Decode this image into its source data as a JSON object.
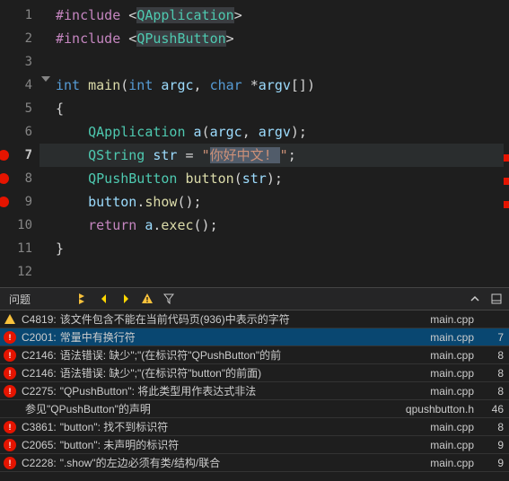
{
  "editor": {
    "currentLine": 7,
    "errorLines": [
      7,
      8,
      9
    ],
    "lines": [
      {
        "num": 1,
        "tokens": [
          {
            "t": "#include ",
            "c": "k-pre"
          },
          {
            "t": "<",
            "c": "k-ang"
          },
          {
            "t": "QApplication",
            "c": "k-inc"
          },
          {
            "t": ">",
            "c": "k-ang"
          }
        ]
      },
      {
        "num": 2,
        "tokens": [
          {
            "t": "#include ",
            "c": "k-pre"
          },
          {
            "t": "<",
            "c": "k-ang"
          },
          {
            "t": "QPushButton",
            "c": "k-inc"
          },
          {
            "t": ">",
            "c": "k-ang"
          }
        ]
      },
      {
        "num": 3,
        "tokens": []
      },
      {
        "num": 4,
        "tokens": [
          {
            "t": "int ",
            "c": "k-key"
          },
          {
            "t": "main",
            "c": "k-func"
          },
          {
            "t": "(",
            "c": "k-punc"
          },
          {
            "t": "int ",
            "c": "k-key"
          },
          {
            "t": "argc",
            "c": "k-var"
          },
          {
            "t": ", ",
            "c": "k-punc"
          },
          {
            "t": "char ",
            "c": "k-key"
          },
          {
            "t": "*",
            "c": "k-punc"
          },
          {
            "t": "argv",
            "c": "k-var"
          },
          {
            "t": "[])",
            "c": "k-punc"
          }
        ]
      },
      {
        "num": 5,
        "tokens": [
          {
            "t": "{",
            "c": "k-punc"
          }
        ]
      },
      {
        "num": 6,
        "tokens": [
          {
            "t": "    ",
            "c": ""
          },
          {
            "t": "QApplication ",
            "c": "k-type"
          },
          {
            "t": "a",
            "c": "k-var"
          },
          {
            "t": "(",
            "c": "k-punc"
          },
          {
            "t": "argc",
            "c": "k-var"
          },
          {
            "t": ", ",
            "c": "k-punc"
          },
          {
            "t": "argv",
            "c": "k-var"
          },
          {
            "t": ");",
            "c": "k-punc"
          }
        ]
      },
      {
        "num": 7,
        "tokens": [
          {
            "t": "    ",
            "c": ""
          },
          {
            "t": "QString ",
            "c": "k-type"
          },
          {
            "t": "str ",
            "c": "k-var"
          },
          {
            "t": "= ",
            "c": "k-punc"
          },
          {
            "t": "\"",
            "c": "k-str"
          },
          {
            "t": "你好中文! ",
            "c": "k-str hl-str"
          },
          {
            "t": "\"",
            "c": "k-str"
          },
          {
            "t": ";",
            "c": "k-punc"
          }
        ]
      },
      {
        "num": 8,
        "tokens": [
          {
            "t": "    ",
            "c": ""
          },
          {
            "t": "QPushButton ",
            "c": "k-type"
          },
          {
            "t": "button",
            "c": "k-func"
          },
          {
            "t": "(",
            "c": "k-punc"
          },
          {
            "t": "str",
            "c": "k-var"
          },
          {
            "t": ");",
            "c": "k-punc"
          }
        ]
      },
      {
        "num": 9,
        "tokens": [
          {
            "t": "    ",
            "c": ""
          },
          {
            "t": "button",
            "c": "k-var"
          },
          {
            "t": ".",
            "c": "k-punc"
          },
          {
            "t": "show",
            "c": "k-func"
          },
          {
            "t": "();",
            "c": "k-punc"
          }
        ]
      },
      {
        "num": 10,
        "tokens": [
          {
            "t": "    ",
            "c": ""
          },
          {
            "t": "return ",
            "c": "k-pre"
          },
          {
            "t": "a",
            "c": "k-var"
          },
          {
            "t": ".",
            "c": "k-punc"
          },
          {
            "t": "exec",
            "c": "k-func"
          },
          {
            "t": "();",
            "c": "k-punc"
          }
        ]
      },
      {
        "num": 11,
        "tokens": [
          {
            "t": "}",
            "c": "k-punc"
          }
        ]
      },
      {
        "num": 12,
        "tokens": []
      }
    ]
  },
  "problems": {
    "title": "问题",
    "items": [
      {
        "sev": "warn",
        "code": "C4819:",
        "msg": "该文件包含不能在当前代码页(936)中表示的字符",
        "file": "main.cpp",
        "line": ""
      },
      {
        "sev": "err",
        "code": "C2001:",
        "msg": "常量中有换行符",
        "file": "main.cpp",
        "line": "7"
      },
      {
        "sev": "err",
        "code": "C2146:",
        "msg": "语法错误: 缺少\";\"(在标识符\"QPushButton\"的前",
        "file": "main.cpp",
        "line": "8"
      },
      {
        "sev": "err",
        "code": "C2146:",
        "msg": "语法错误: 缺少\";\"(在标识符\"button\"的前面)",
        "file": "main.cpp",
        "line": "8"
      },
      {
        "sev": "err",
        "code": "C2275:",
        "msg": "\"QPushButton\": 将此类型用作表达式非法",
        "file": "main.cpp",
        "line": "8"
      },
      {
        "sev": "ref",
        "code": "",
        "msg": "参见\"QPushButton\"的声明",
        "file": "qpushbutton.h",
        "line": "46"
      },
      {
        "sev": "err",
        "code": "C3861:",
        "msg": "\"button\": 找不到标识符",
        "file": "main.cpp",
        "line": "8"
      },
      {
        "sev": "err",
        "code": "C2065:",
        "msg": "\"button\": 未声明的标识符",
        "file": "main.cpp",
        "line": "9"
      },
      {
        "sev": "err",
        "code": "C2228:",
        "msg": "\".show\"的左边必须有类/结构/联合",
        "file": "main.cpp",
        "line": "9"
      }
    ]
  }
}
